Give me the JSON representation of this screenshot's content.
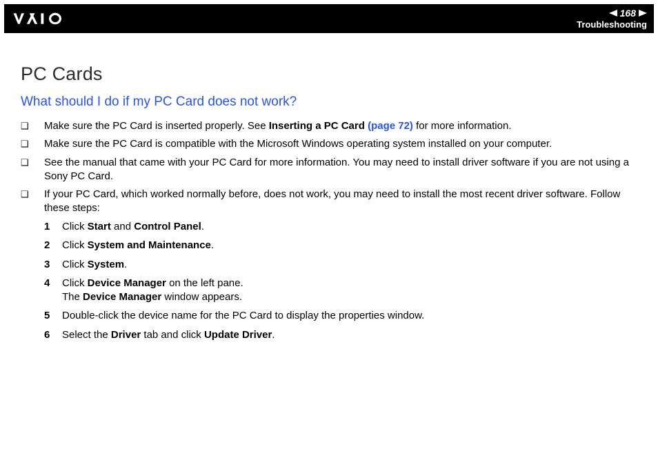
{
  "header": {
    "page_number": "168",
    "section": "Troubleshooting"
  },
  "title": "PC Cards",
  "subtitle": "What should I do if my PC Card does not work?",
  "bullets": [
    {
      "pre": "Make sure the PC Card is inserted properly. See ",
      "bold1": "Inserting a PC Card ",
      "link": "(page 72)",
      "post": " for more information."
    },
    {
      "text": "Make sure the PC Card is compatible with the Microsoft Windows operating system installed on your computer."
    },
    {
      "text": "See the manual that came with your PC Card for more information. You may need to install driver software if you are not using a Sony PC Card."
    },
    {
      "text": "If your PC Card, which worked normally before, does not work, you may need to install the most recent driver software. Follow these steps:"
    }
  ],
  "steps": [
    {
      "n": "1",
      "pre": "Click ",
      "b1": "Start",
      "mid": " and ",
      "b2": "Control Panel",
      "post": "."
    },
    {
      "n": "2",
      "pre": "Click ",
      "b1": "System and Maintenance",
      "post": "."
    },
    {
      "n": "3",
      "pre": "Click ",
      "b1": "System",
      "post": "."
    },
    {
      "n": "4",
      "pre": "Click ",
      "b1": "Device Manager",
      "mid": " on the left pane.",
      "line2pre": "The ",
      "line2b": "Device Manager",
      "line2post": " window appears."
    },
    {
      "n": "5",
      "text": "Double-click the device name for the PC Card to display the properties window."
    },
    {
      "n": "6",
      "pre": "Select the ",
      "b1": "Driver",
      "mid": " tab and click ",
      "b2": "Update Driver",
      "post": "."
    }
  ]
}
